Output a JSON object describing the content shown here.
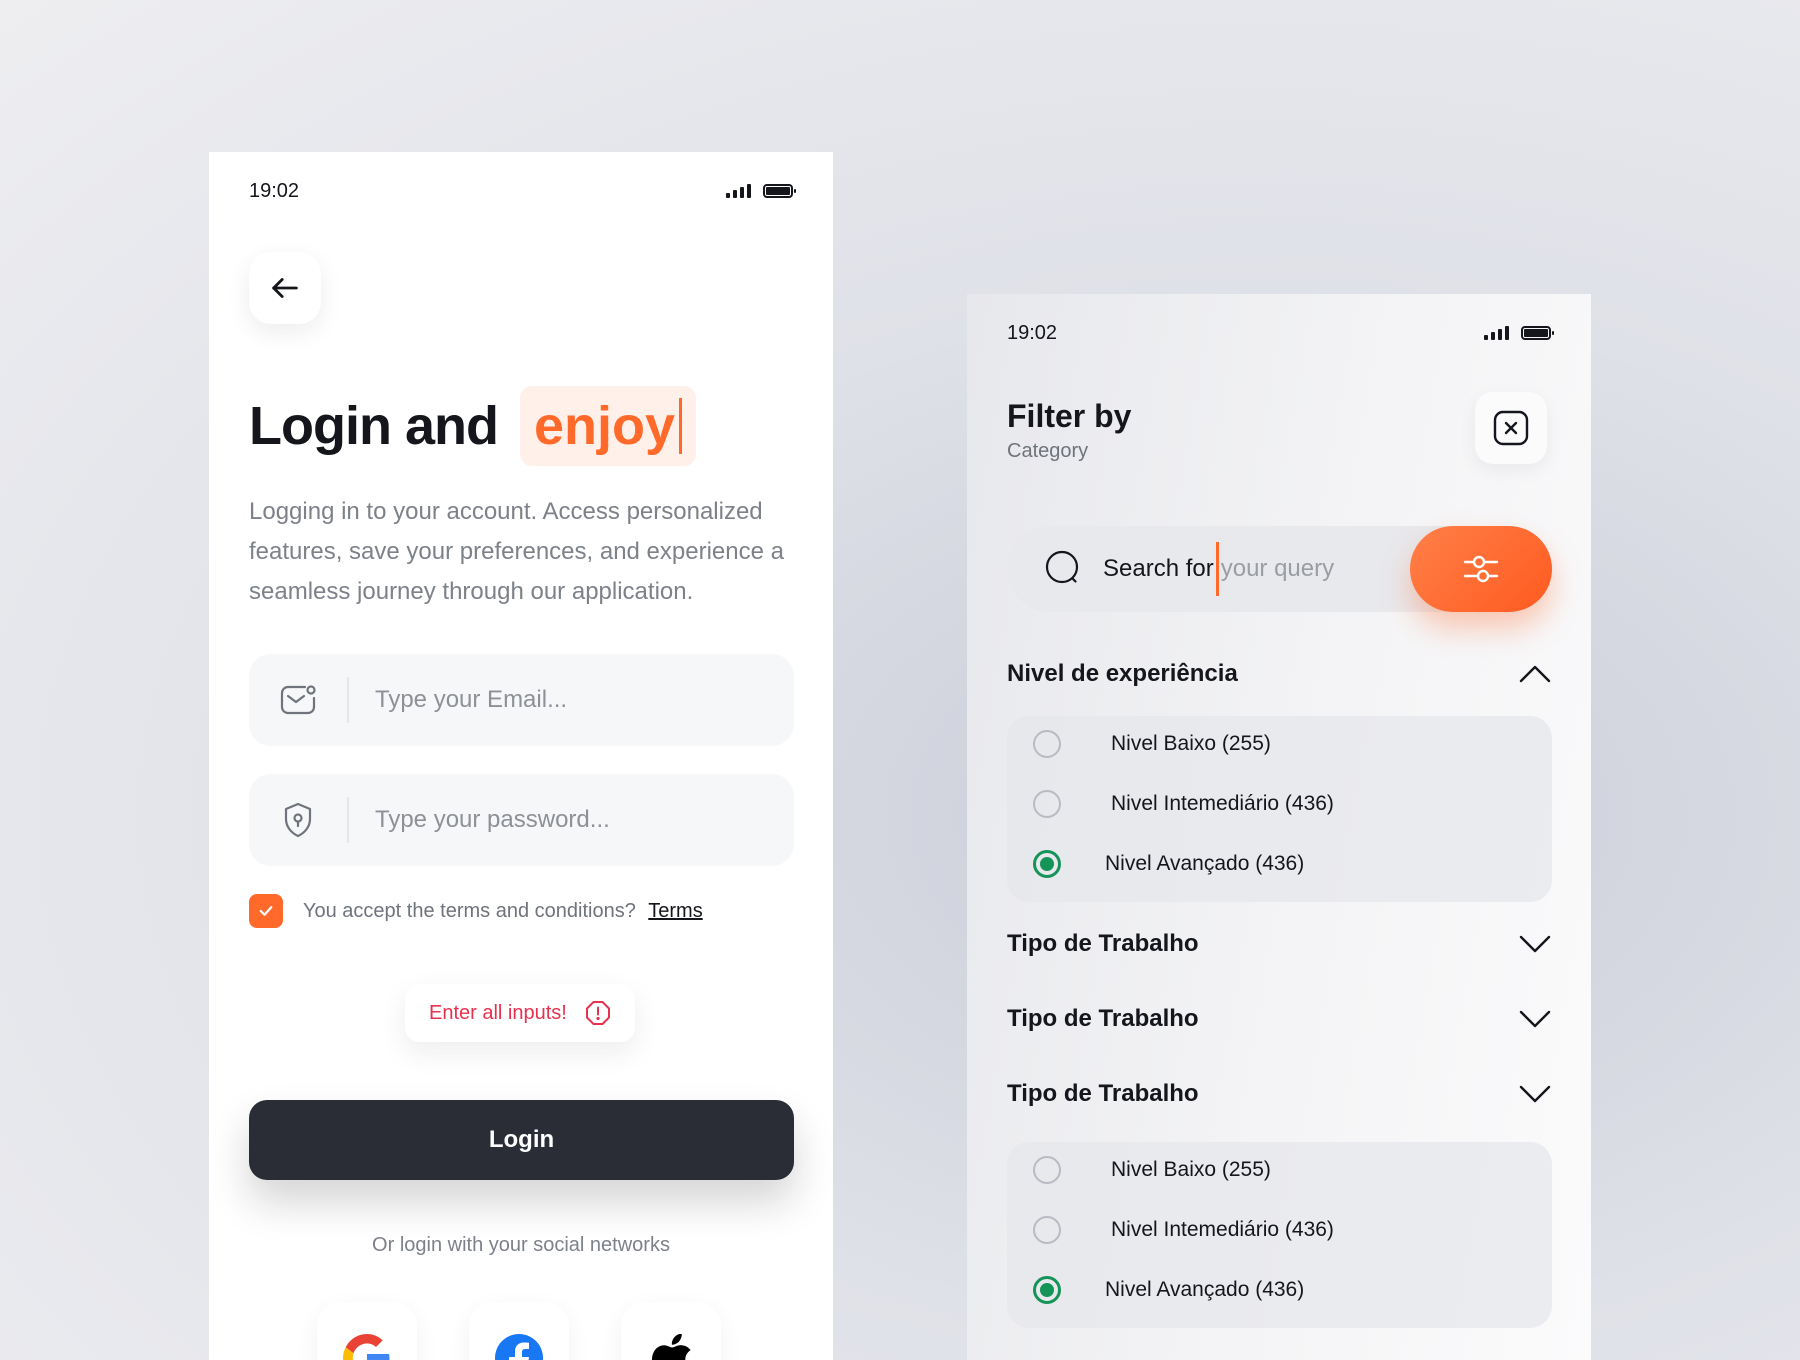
{
  "login": {
    "status": {
      "time": "19:02"
    },
    "headline": {
      "main": "Login and",
      "accent": "enjoy"
    },
    "description": "Logging in to your account. Access personalized features, save your preferences, and experience a seamless journey through our application.",
    "email": {
      "placeholder": "Type your Email..."
    },
    "password": {
      "placeholder": "Type your password..."
    },
    "terms": {
      "question": "You accept the terms and conditions?",
      "link": "Terms",
      "checked": true
    },
    "alert": {
      "text": "Enter all inputs!"
    },
    "login_button": "Login",
    "social": {
      "caption": "Or login with your social networks",
      "providers": [
        "google-icon",
        "facebook-icon",
        "apple-icon"
      ]
    }
  },
  "filter": {
    "status": {
      "time": "19:02"
    },
    "title": "Filter by",
    "subtitle": "Category",
    "search": {
      "typed": "Search for",
      "placeholder": "your query"
    },
    "sections": [
      {
        "title": "Nivel de experiência",
        "expanded": true,
        "options": [
          {
            "label": "Nivel Baixo (255)",
            "selected": false
          },
          {
            "label": "Nivel Intemediário (436)",
            "selected": false
          },
          {
            "label": "Nivel Avançado (436)",
            "selected": true
          }
        ]
      },
      {
        "title": "Tipo de Trabalho",
        "expanded": false
      },
      {
        "title": "Tipo de Trabalho",
        "expanded": false
      },
      {
        "title": "Tipo de Trabalho",
        "expanded": true,
        "options": [
          {
            "label": "Nivel Baixo (255)",
            "selected": false
          },
          {
            "label": "Nivel Intemediário (436)",
            "selected": false
          },
          {
            "label": "Nivel Avançado (436)",
            "selected": true
          }
        ]
      }
    ]
  },
  "colors": {
    "accent": "#ff6a2a",
    "dark": "#2a2d36",
    "success": "#15945a",
    "error": "#e8314f"
  }
}
